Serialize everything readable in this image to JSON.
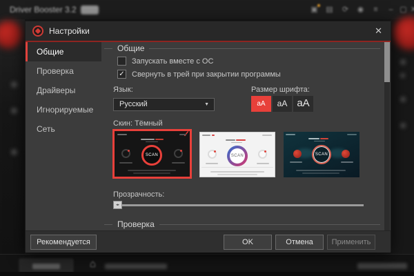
{
  "colors": {
    "accent_red": "#e8403a",
    "dialog_bg": "#3c3c3c",
    "titlebar_bg": "#282828",
    "selected_item_bg": "#2b2b2b"
  },
  "icons": {
    "close": "✕",
    "dropdown_arrow": "▼",
    "check": "✓",
    "home": "⌂",
    "minimize": "–",
    "maximize": "▢",
    "hamburger": "≡",
    "refresh": "⟳",
    "gift": "▣",
    "user": "◉",
    "slider_marks": "◂▸"
  },
  "background": {
    "title": "Driver Booster 3.2"
  },
  "dialog": {
    "title": "Настройки",
    "sidebar": {
      "items": [
        {
          "label": "Общие",
          "selected": true
        },
        {
          "label": "Проверка",
          "selected": false
        },
        {
          "label": "Драйверы",
          "selected": false
        },
        {
          "label": "Игнорируемые",
          "selected": false
        },
        {
          "label": "Сеть",
          "selected": false
        }
      ]
    },
    "general": {
      "header": "Общие",
      "checkboxes": [
        {
          "label": "Запускать вместе с ОС",
          "checked": false
        },
        {
          "label": "Свернуть в трей при закрытии программы",
          "checked": true
        }
      ],
      "language": {
        "label": "Язык:",
        "value": "Русский"
      },
      "font_size": {
        "label": "Размер шрифта:",
        "options": [
          "aA",
          "aA",
          "aA"
        ],
        "selected_index": 0
      },
      "skin": {
        "label": "Скин: Тёмный",
        "thumbs": [
          {
            "theme": "dark",
            "scan_label": "SCAN",
            "selected": true
          },
          {
            "theme": "light",
            "scan_label": "SCAN",
            "selected": false
          },
          {
            "theme": "teal",
            "scan_label": "SCAN",
            "selected": false
          }
        ]
      },
      "transparency": {
        "label": "Прозрачность:",
        "value_percent": 0
      }
    },
    "next_section": {
      "header": "Проверка"
    },
    "footer": {
      "recommended": "Рекомендуется",
      "ok": "OK",
      "cancel": "Отмена",
      "apply": "Применить",
      "apply_enabled": false
    }
  }
}
